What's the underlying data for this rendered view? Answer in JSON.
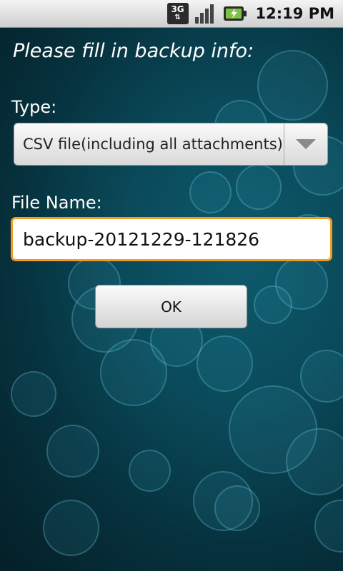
{
  "status_bar": {
    "network_label": "3G",
    "time": "12:19 PM",
    "icons": [
      "3g-icon",
      "signal-icon",
      "battery-charging-icon"
    ]
  },
  "form": {
    "title": "Please fill in backup info:",
    "type_label": "Type:",
    "type_selected": "CSV file(including all attachments)",
    "filename_label": "File Name:",
    "filename_value": "backup-20121229-121826",
    "ok_label": "OK"
  },
  "colors": {
    "focus_border": "#f39c1e",
    "background": "#0a4a5a"
  }
}
